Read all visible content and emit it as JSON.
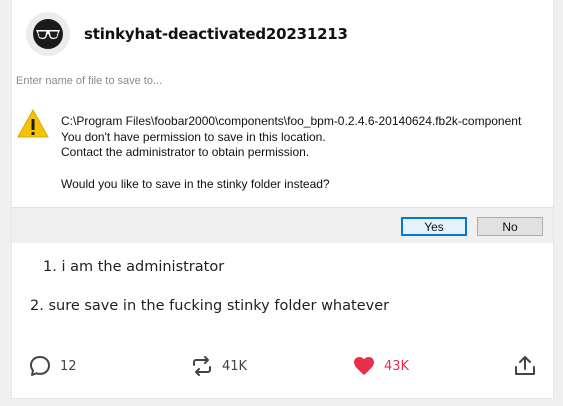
{
  "post": {
    "username": "stinkyhat-deactivated20231213"
  },
  "dialog": {
    "filename_placeholder": "Enter name of file to save to...",
    "path": "C:\\Program Files\\foobar2000\\components\\foo_bpm-0.2.4.6-20140624.fb2k-component",
    "line2": "You don't have permission to save in this location.",
    "line3": "Contact the administrator to obtain permission.",
    "question": "Would you like to save in the stinky folder instead?",
    "yes_label": "Yes",
    "no_label": "No",
    "icon": "warning-icon"
  },
  "body": {
    "item1": "1. i am the administrator",
    "item2": "2. sure save in the fucking stinky folder whatever"
  },
  "footer": {
    "comments": "12",
    "reblogs": "41K",
    "likes": "43K",
    "like_color": "#e8304a"
  }
}
